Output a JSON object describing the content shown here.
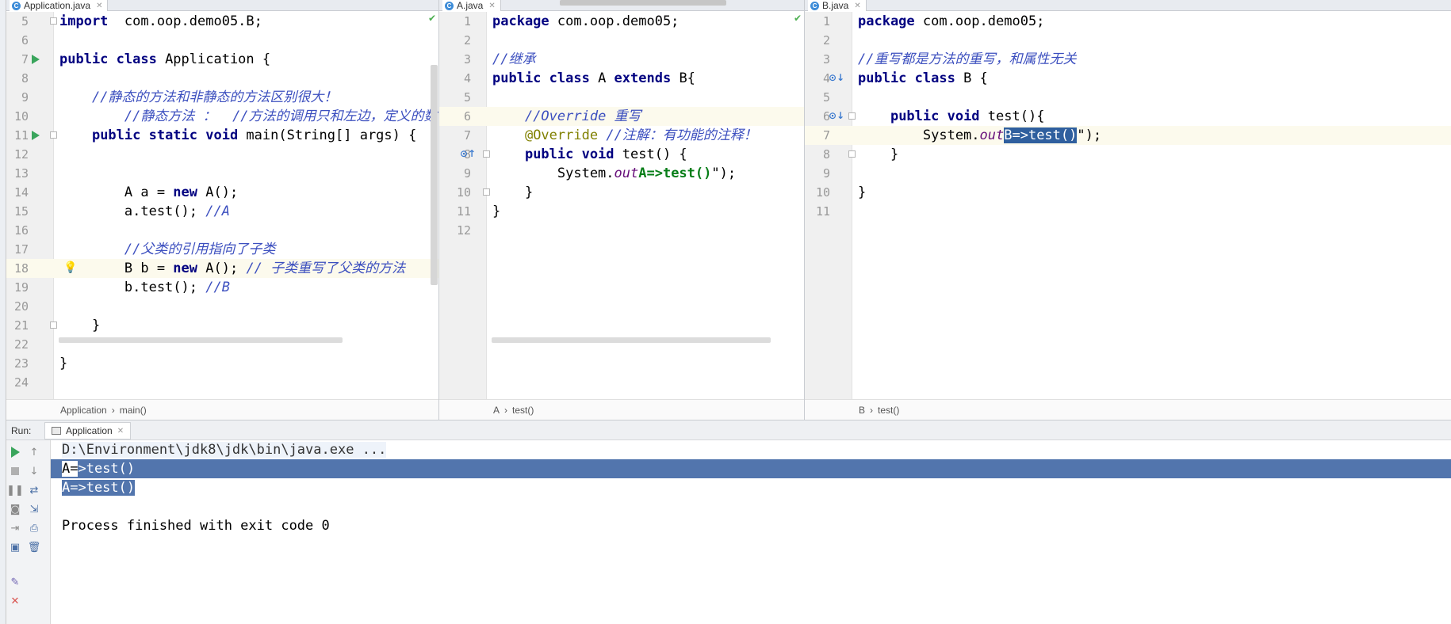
{
  "panes": {
    "left": {
      "tab": "Application.java",
      "breadcrumb": [
        "Application",
        "main()"
      ],
      "lines": [
        {
          "n": "5",
          "t": [
            [
              "kw",
              "import"
            ],
            [
              "",
              "  com.oop.demo05.B;"
            ]
          ]
        },
        {
          "n": "6",
          "t": []
        },
        {
          "n": "7",
          "t": [
            [
              "kw",
              "public class"
            ],
            [
              "",
              " Application {"
            ]
          ]
        },
        {
          "n": "8",
          "t": []
        },
        {
          "n": "9",
          "t": [
            [
              "",
              "    "
            ],
            [
              "cm",
              "//静态的方法和非静态的方法区别很大！"
            ]
          ]
        },
        {
          "n": "10",
          "t": [
            [
              "",
              "        "
            ],
            [
              "cm",
              "//静态方法 ：  //方法的调用只和左边，定义的数"
            ]
          ]
        },
        {
          "n": "11",
          "t": [
            [
              "",
              "    "
            ],
            [
              "kw",
              "public static void"
            ],
            [
              "",
              " main(String[] args) {"
            ]
          ]
        },
        {
          "n": "12",
          "t": []
        },
        {
          "n": "13",
          "t": []
        },
        {
          "n": "14",
          "t": [
            [
              "",
              "        A a = "
            ],
            [
              "kw",
              "new"
            ],
            [
              "",
              " A();"
            ]
          ]
        },
        {
          "n": "15",
          "t": [
            [
              "",
              "        a.test(); "
            ],
            [
              "cm",
              "//A"
            ]
          ]
        },
        {
          "n": "16",
          "t": []
        },
        {
          "n": "17",
          "t": [
            [
              "",
              "        "
            ],
            [
              "cm",
              "//父类的引用指向了子类"
            ]
          ]
        },
        {
          "n": "18",
          "t": [
            [
              "",
              "        B b = "
            ],
            [
              "kw",
              "new"
            ],
            [
              "",
              " A(); "
            ],
            [
              "cm",
              "// 子类重写了父类的方法"
            ]
          ]
        },
        {
          "n": "19",
          "t": [
            [
              "",
              "        b.test(); "
            ],
            [
              "cm",
              "//B"
            ]
          ]
        },
        {
          "n": "20",
          "t": []
        },
        {
          "n": "21",
          "t": [
            [
              "",
              "    }"
            ]
          ]
        },
        {
          "n": "22",
          "t": []
        },
        {
          "n": "23",
          "t": [
            [
              "",
              "}"
            ]
          ]
        },
        {
          "n": "24",
          "t": []
        }
      ]
    },
    "middle": {
      "tab": "A.java",
      "breadcrumb": [
        "A",
        "test()"
      ],
      "lines": [
        {
          "n": "1",
          "t": [
            [
              "kw",
              "package"
            ],
            [
              "",
              " com.oop.demo05;"
            ]
          ]
        },
        {
          "n": "2",
          "t": []
        },
        {
          "n": "3",
          "t": [
            [
              "cm",
              "//继承"
            ]
          ]
        },
        {
          "n": "4",
          "t": [
            [
              "kw",
              "public class"
            ],
            [
              "",
              " A "
            ],
            [
              "kw",
              "extends"
            ],
            [
              "",
              " B{"
            ]
          ]
        },
        {
          "n": "5",
          "t": []
        },
        {
          "n": "6",
          "t": [
            [
              "",
              "    "
            ],
            [
              "cm",
              "//Override 重写"
            ]
          ]
        },
        {
          "n": "7",
          "t": [
            [
              "",
              "    "
            ],
            [
              "ann",
              "@Override"
            ],
            [
              "",
              " "
            ],
            [
              "cm",
              "//注解：有功能的注释！"
            ]
          ]
        },
        {
          "n": "8",
          "t": [
            [
              "",
              "    "
            ],
            [
              "kw",
              "public void"
            ],
            [
              "",
              " test() {"
            ]
          ]
        },
        {
          "n": "9",
          "t": [
            [
              "",
              "        System."
            ],
            [
              "fld",
              "out"
            ],
            [
              ".println(\""
            ],
            [
              "str",
              "A=>test()"
            ],
            [
              "",
              "\");"
            ]
          ]
        },
        {
          "n": "10",
          "t": [
            [
              "",
              "    }"
            ]
          ]
        },
        {
          "n": "11",
          "t": [
            [
              "",
              "}"
            ]
          ]
        },
        {
          "n": "12",
          "t": []
        }
      ]
    },
    "right": {
      "tab": "B.java",
      "breadcrumb": [
        "B",
        "test()"
      ],
      "lines": [
        {
          "n": "1",
          "t": [
            [
              "kw",
              "package"
            ],
            [
              "",
              " com.oop.demo05;"
            ]
          ]
        },
        {
          "n": "2",
          "t": []
        },
        {
          "n": "3",
          "t": [
            [
              "cm",
              "//重写都是方法的重写，和属性无关"
            ]
          ]
        },
        {
          "n": "4",
          "t": [
            [
              "kw",
              "public class"
            ],
            [
              "",
              " B {"
            ]
          ]
        },
        {
          "n": "5",
          "t": []
        },
        {
          "n": "6",
          "t": [
            [
              "",
              "    "
            ],
            [
              "kw",
              "public void"
            ],
            [
              "",
              " test(){"
            ]
          ]
        },
        {
          "n": "7",
          "t": [
            [
              "",
              "        System."
            ],
            [
              "fld",
              "out"
            ],
            [
              ".println(\""
            ],
            [
              "sel",
              "B=>test()"
            ],
            [
              "",
              "\");"
            ]
          ]
        },
        {
          "n": "8",
          "t": [
            [
              "",
              "    }"
            ]
          ]
        },
        {
          "n": "9",
          "t": []
        },
        {
          "n": "10",
          "t": [
            [
              "",
              "}"
            ]
          ]
        },
        {
          "n": "11",
          "t": []
        }
      ]
    }
  },
  "run": {
    "label": "Run:",
    "tab": "Application",
    "command": "D:\\Environment\\jdk8\\jdk\\bin\\java.exe ...",
    "output_line1_prefix": "A=",
    "output_line1_rest": ">test()",
    "output_line2": "A=>test()",
    "finish": "Process finished with exit code 0"
  },
  "colors": {
    "keyword": "#000080",
    "comment": "#3c4fbf",
    "string": "#067d17",
    "selection": "#2f5f9e",
    "run_green": "#3aa55c"
  }
}
